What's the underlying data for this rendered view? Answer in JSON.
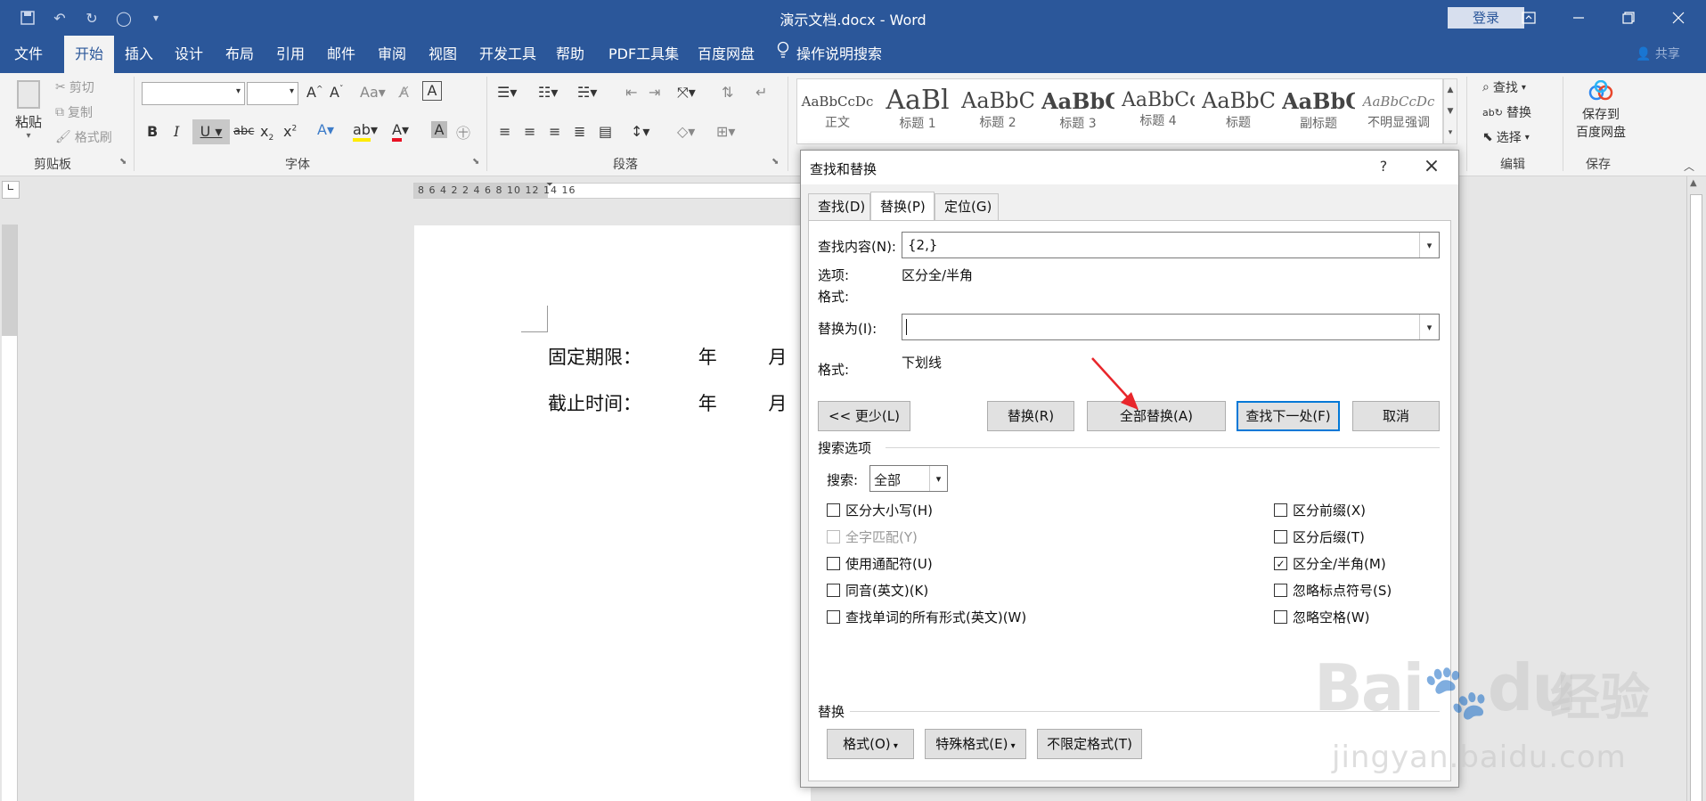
{
  "titlebar": {
    "title": "演示文档.docx - Word",
    "login": "登录"
  },
  "ribbon_tabs": [
    "文件",
    "开始",
    "插入",
    "设计",
    "布局",
    "引用",
    "邮件",
    "审阅",
    "视图",
    "开发工具",
    "帮助",
    "PDF工具集",
    "百度网盘"
  ],
  "active_tab_index": 1,
  "tell_me": "操作说明搜索",
  "share": "共享",
  "clipboard": {
    "paste": "粘贴",
    "cut": "剪切",
    "copy": "复制",
    "format_painter": "格式刷",
    "label": "剪贴板"
  },
  "font_group": {
    "label": "字体"
  },
  "paragraph_group": {
    "label": "段落"
  },
  "styles": [
    {
      "sample": "AaBbCcDc",
      "name": "正文"
    },
    {
      "sample": "AaBl",
      "name": "标题 1"
    },
    {
      "sample": "AaBbC",
      "name": "标题 2"
    },
    {
      "sample": "AaBbC",
      "name": "标题 3"
    },
    {
      "sample": "AaBbCc",
      "name": "标题 4"
    },
    {
      "sample": "AaBbC",
      "name": "标题"
    },
    {
      "sample": "AaBbC",
      "name": "副标题"
    },
    {
      "sample": "AaBbCcDc",
      "name": "不明显强调"
    }
  ],
  "editing": {
    "find": "查找",
    "replace": "替换",
    "select": "选择",
    "label": "编辑"
  },
  "save_group": {
    "line1": "保存到",
    "line2": "百度网盘",
    "label": "保存"
  },
  "ruler": {
    "numbers": "8  6  4  2     2  4  6  8  10  12  14  16"
  },
  "document": {
    "lines": [
      {
        "label": "固定期限：",
        "year": "年",
        "month": "月"
      },
      {
        "label": "截止时间：",
        "year": "年",
        "month": "月"
      }
    ]
  },
  "dialog": {
    "title": "查找和替换",
    "help": "?",
    "tabs": [
      "查找(D)",
      "替换(P)",
      "定位(G)"
    ],
    "active_tab_index": 1,
    "find_label": "查找内容(N):",
    "find_value": "{2,}",
    "options_label": "选项:",
    "options_value": "区分全/半角",
    "format_label": "格式:",
    "replace_label": "替换为(I):",
    "replace_value": "",
    "replace_format_label": "格式:",
    "replace_format_value": "下划线",
    "buttons": {
      "less": "<< 更少(L)",
      "replace": "替换(R)",
      "replace_all": "全部替换(A)",
      "find_next": "查找下一处(F)",
      "cancel": "取消"
    },
    "search_options_title": "搜索选项",
    "search_label": "搜索:",
    "search_value": "全部",
    "left_checks": [
      {
        "label": "区分大小写(H)",
        "checked": false,
        "disabled": false
      },
      {
        "label": "全字匹配(Y)",
        "checked": false,
        "disabled": true
      },
      {
        "label": "使用通配符(U)",
        "checked": false,
        "disabled": false
      },
      {
        "label": "同音(英文)(K)",
        "checked": false,
        "disabled": false
      },
      {
        "label": "查找单词的所有形式(英文)(W)",
        "checked": false,
        "disabled": false
      }
    ],
    "right_checks": [
      {
        "label": "区分前缀(X)",
        "checked": false
      },
      {
        "label": "区分后缀(T)",
        "checked": false
      },
      {
        "label": "区分全/半角(M)",
        "checked": true
      },
      {
        "label": "忽略标点符号(S)",
        "checked": false
      },
      {
        "label": "忽略空格(W)",
        "checked": false
      }
    ],
    "replace_section_title": "替换",
    "bottom_buttons": {
      "format": "格式(O)",
      "special": "特殊格式(E)",
      "no_format": "不限定格式(T)"
    }
  },
  "watermark": {
    "brand": "Bai",
    "brand_suffix": "du",
    "cn": "经验",
    "url": "jingyan.baidu.com"
  },
  "colors": {
    "word_blue": "#2b579a",
    "arrow_red": "#e8262b",
    "default_btn": "#0078d7"
  }
}
